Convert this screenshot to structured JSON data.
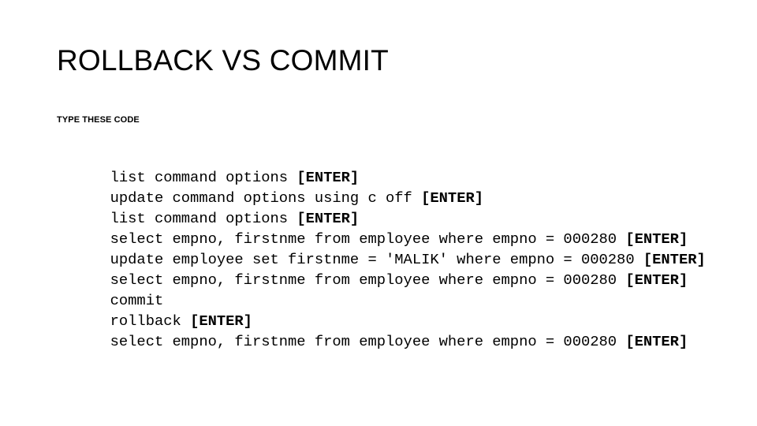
{
  "slide": {
    "title": "ROLLBACK VS COMMIT",
    "subtitle": "TYPE THESE CODE",
    "background_color": "#ffffff",
    "text_color": "#000000"
  },
  "code": {
    "key_token": "[ENTER]",
    "lines": [
      {
        "text": "list command options ",
        "key": "[ENTER]"
      },
      {
        "text": "update command options using c off ",
        "key": "[ENTER]"
      },
      {
        "text": "list command options ",
        "key": "[ENTER]"
      },
      {
        "text": "select empno, firstnme from employee where empno = 000280 ",
        "key": "[ENTER]"
      },
      {
        "text": "update employee set firstnme = 'MALIK' where empno = 000280 ",
        "key": "[ENTER]"
      },
      {
        "text": "select empno, firstnme from employee where empno = 000280 ",
        "key": "[ENTER]"
      },
      {
        "text": "commit",
        "key": ""
      },
      {
        "text": "rollback ",
        "key": "[ENTER]"
      },
      {
        "text": "select empno, firstnme from employee where empno = 000280 ",
        "key": "[ENTER]"
      }
    ]
  }
}
